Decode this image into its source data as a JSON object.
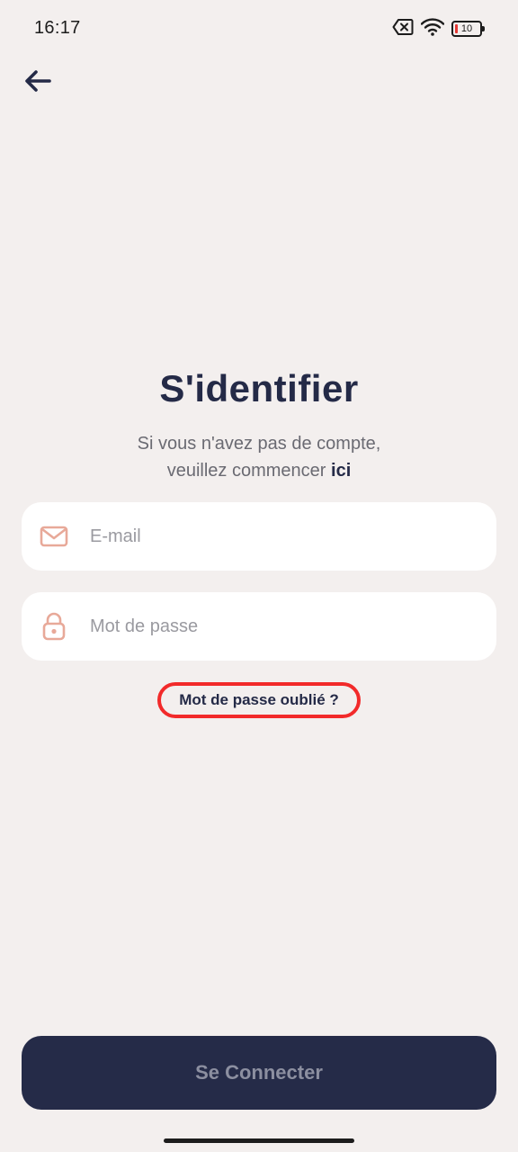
{
  "status_bar": {
    "time": "16:17",
    "battery_level": "10",
    "icons": [
      "no-sim-icon",
      "wifi-icon",
      "battery-icon"
    ]
  },
  "header": {
    "back_icon": "arrow-left-icon"
  },
  "login": {
    "title": "S'identifier",
    "subtitle_line1": "Si vous n'avez pas de compte,",
    "subtitle_line2_prefix": "veuillez commencer ",
    "subtitle_link": "ici",
    "email": {
      "placeholder": "E-mail",
      "value": "",
      "icon": "mail-icon"
    },
    "password": {
      "placeholder": "Mot de passe",
      "value": "",
      "icon": "lock-icon"
    },
    "forgot_password": "Mot de passe oublié ?",
    "submit_label": "Se Connecter"
  },
  "colors": {
    "background": "#f3efee",
    "primary": "#252b48",
    "icon_accent": "#e8a999",
    "highlight": "#f22a2a"
  }
}
